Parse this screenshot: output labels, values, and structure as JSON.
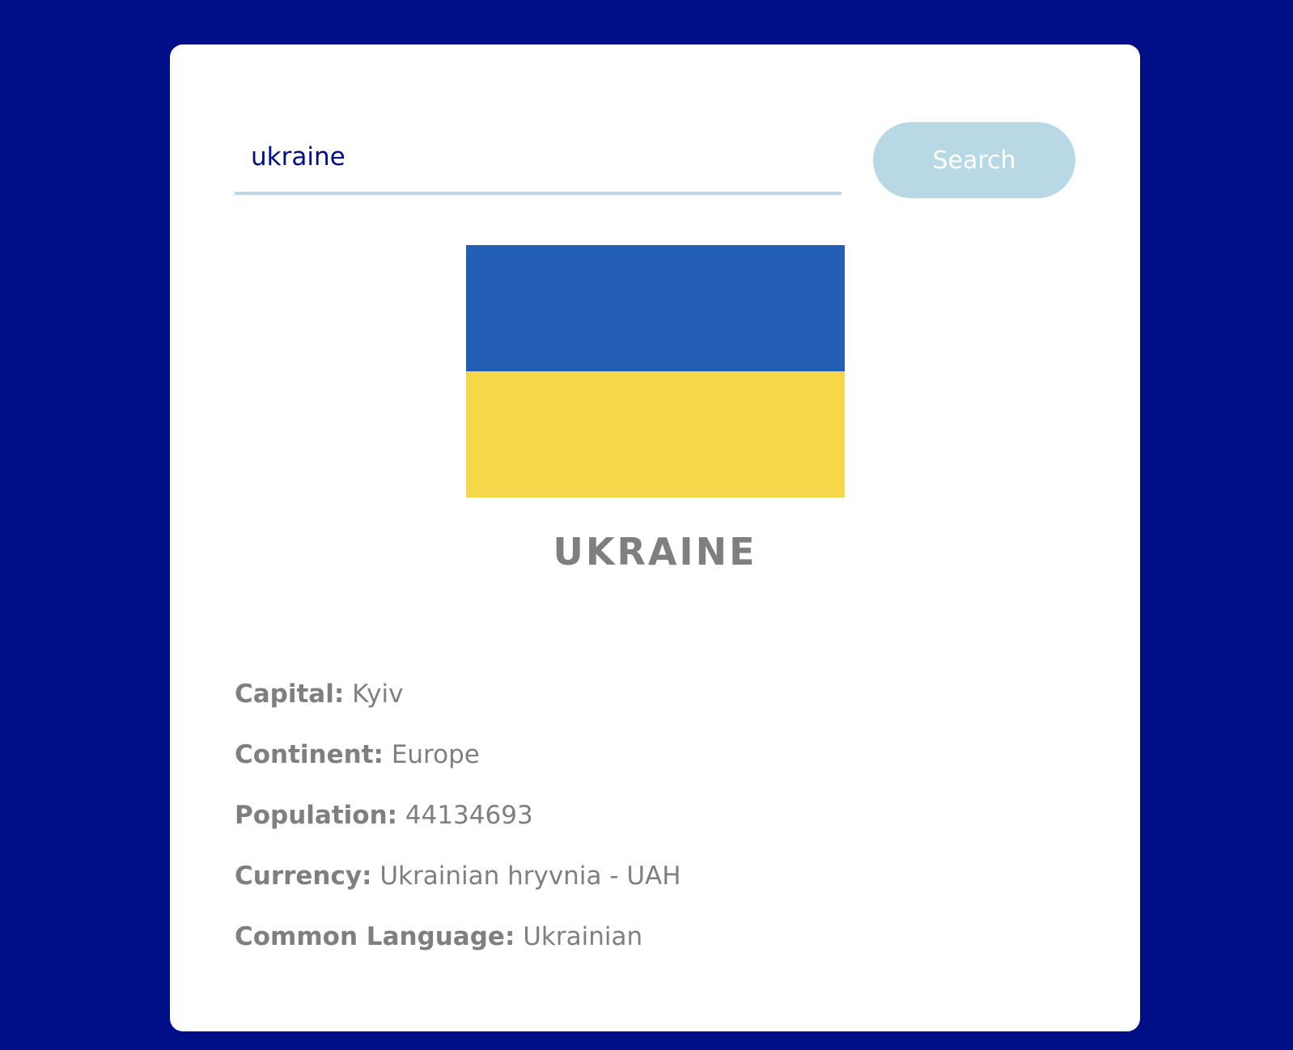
{
  "search": {
    "value": "ukraine",
    "button_label": "Search"
  },
  "country": {
    "name": "UKRAINE",
    "flag": {
      "top_color": "#225fb4",
      "bottom_color": "#f7d74a"
    },
    "details": [
      {
        "label": "Capital:",
        "value": "Kyiv"
      },
      {
        "label": "Continent:",
        "value": "Europe"
      },
      {
        "label": "Population:",
        "value": "44134693"
      },
      {
        "label": "Currency:",
        "value": "Ukrainian hryvnia - UAH"
      },
      {
        "label": "Common Language:",
        "value": "Ukrainian"
      }
    ]
  },
  "colors": {
    "background": "#000f87",
    "accent": "#b7d8e4",
    "text": "#7f7f7f"
  }
}
